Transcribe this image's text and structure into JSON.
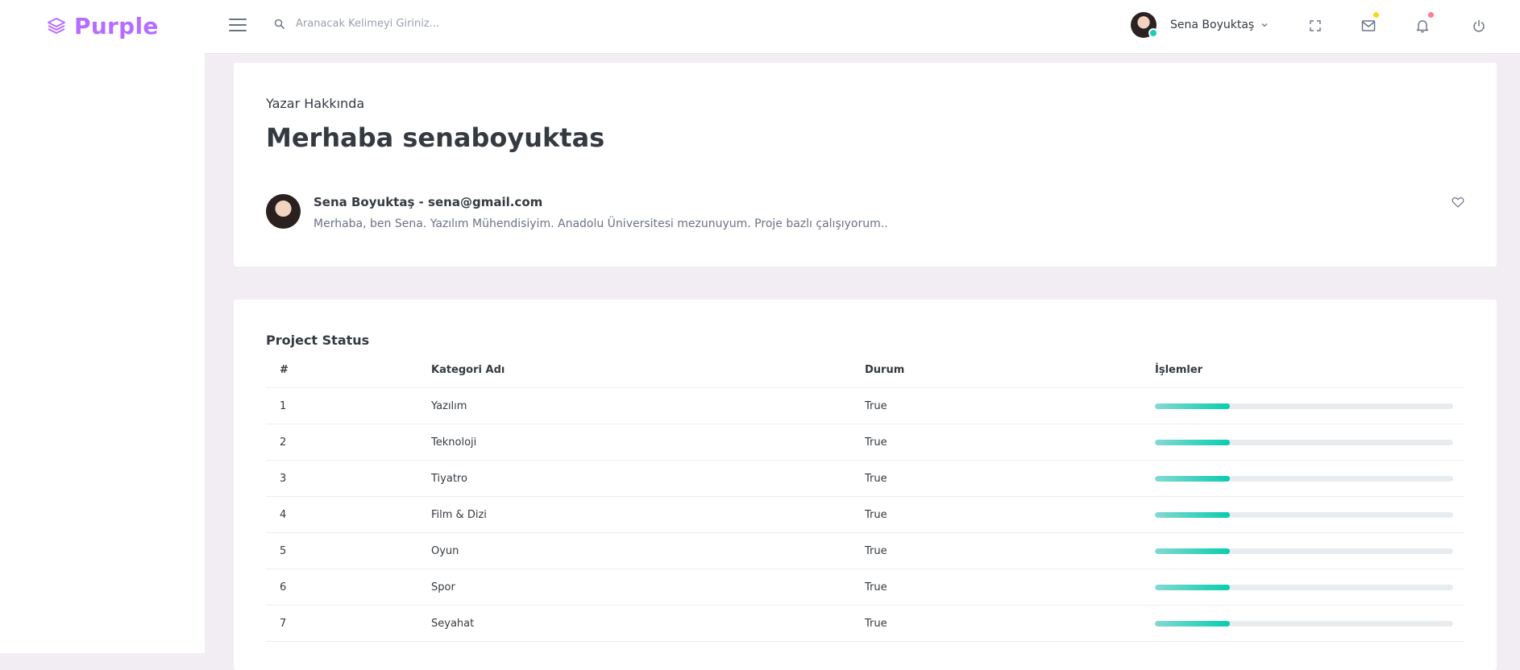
{
  "navbar": {
    "brand": "Purple",
    "search_placeholder": "Aranacak Kelimeyi Giriniz...",
    "profile_name": "Sena Boyuktaş",
    "icons": [
      "fullscreen-icon",
      "mail-icon",
      "bell-icon",
      "power-icon"
    ],
    "badge_colors": {
      "mail": "#fed713",
      "bell": "#fe7c96"
    }
  },
  "about": {
    "subtitle": "Yazar Hakkında",
    "title": "Merhaba senaboyuktas",
    "author_line": "Sena Boyuktaş - sena@gmail.com",
    "bio": "Merhaba, ben Sena. Yazılım Mühendisiyim. Anadolu Üniversitesi mezunuyum. Proje bazlı çalışıyorum.."
  },
  "status": {
    "title": "Project Status",
    "headers": [
      "#",
      "Kategori Adı",
      "Durum",
      "İşlemler"
    ],
    "rows": [
      {
        "num": "1",
        "name": "Yazılım",
        "state": "True",
        "progress": 0.25
      },
      {
        "num": "2",
        "name": "Teknoloji",
        "state": "True",
        "progress": 0.25
      },
      {
        "num": "3",
        "name": "Tiyatro",
        "state": "True",
        "progress": 0.25
      },
      {
        "num": "4",
        "name": "Film & Dizi",
        "state": "True",
        "progress": 0.25
      },
      {
        "num": "5",
        "name": "Oyun",
        "state": "True",
        "progress": 0.25
      },
      {
        "num": "6",
        "name": "Spor",
        "state": "True",
        "progress": 0.25
      },
      {
        "num": "7",
        "name": "Seyahat",
        "state": "True",
        "progress": 0.25
      }
    ]
  },
  "colors": {
    "brand": "#b66dff",
    "progress": "#07cdae",
    "online": "#1bcfb4",
    "background": "#f2edf3"
  }
}
